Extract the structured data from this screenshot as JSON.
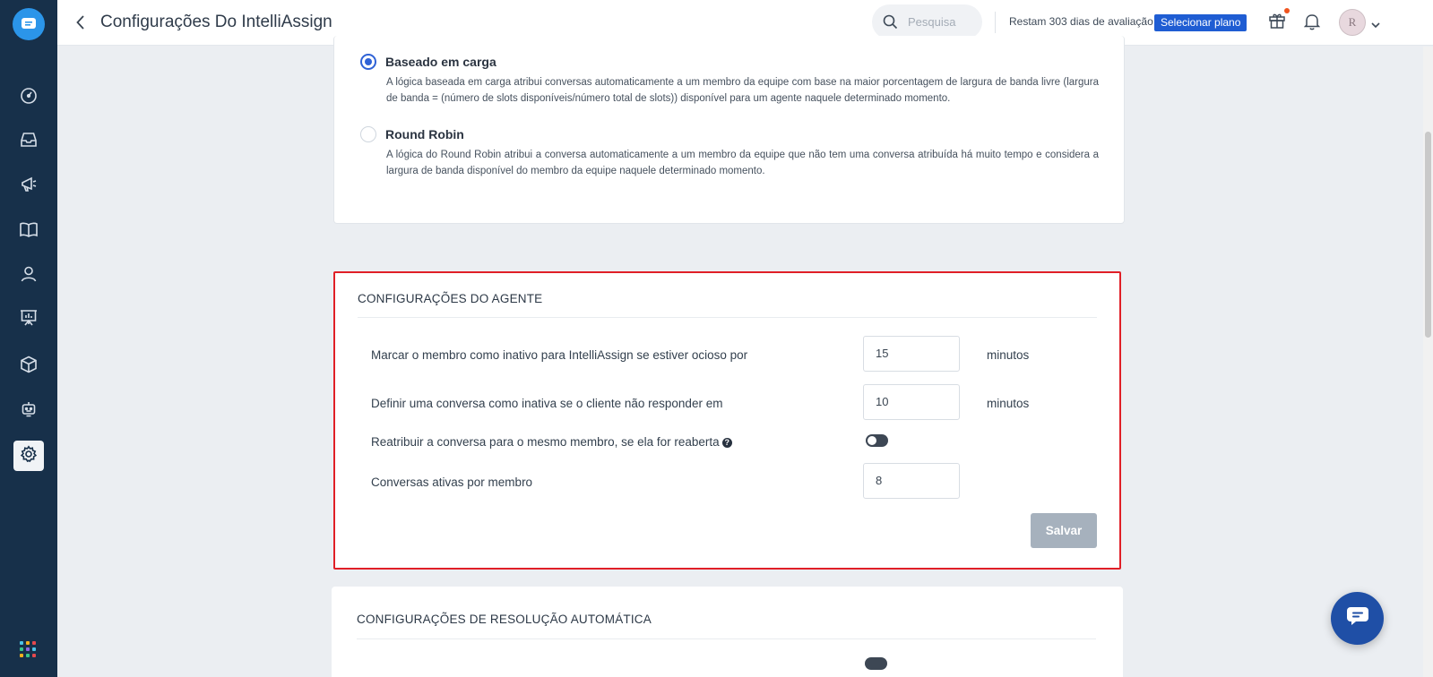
{
  "header": {
    "title": "Configurações Do IntelliAssign",
    "search_placeholder": "Pesquisa",
    "trial_text": "Restam 303 dias de avaliação",
    "plan_button": "Selecionar plano",
    "avatar_initial": "R"
  },
  "sidebar": {
    "items": [
      {
        "icon": "dashboard-icon"
      },
      {
        "icon": "inbox-icon"
      },
      {
        "icon": "megaphone-icon"
      },
      {
        "icon": "book-icon"
      },
      {
        "icon": "user-icon"
      },
      {
        "icon": "presentation-chart-icon"
      },
      {
        "icon": "package-icon"
      },
      {
        "icon": "bot-icon"
      },
      {
        "icon": "gear-icon",
        "active": true
      }
    ]
  },
  "logic": {
    "options": [
      {
        "title": "Baseado em carga",
        "description": "A lógica baseada em carga atribui conversas automaticamente a um membro da equipe com base na maior porcentagem de largura de banda livre (largura de banda = (número de slots disponíveis/número total de slots)) disponível para um agente naquele determinado momento.",
        "selected": true
      },
      {
        "title": "Round Robin",
        "description": "A lógica do Round Robin atribui a conversa automaticamente a um membro da equipe que não tem uma conversa atribuída há muito tempo e considera a largura de banda disponível do membro da equipe naquele determinado momento.",
        "selected": false
      }
    ]
  },
  "agent_settings": {
    "title": "CONFIGURAÇÕES DO AGENTE",
    "inactive_member_label": "Marcar o membro como inativo para IntelliAssign se estiver ocioso por",
    "inactive_member_value": "15",
    "inactive_member_unit": "minutos",
    "inactive_conversation_label": "Definir uma conversa como inativa se o cliente não responder em",
    "inactive_conversation_value": "10",
    "inactive_conversation_unit": "minutos",
    "reassign_label": "Reatribuir a conversa para o mesmo membro, se ela for reaberta",
    "reassign_enabled": false,
    "active_conversations_label": "Conversas ativas por membro",
    "active_conversations_value": "8",
    "save_button": "Salvar"
  },
  "auto_resolution": {
    "title": "CONFIGURAÇÕES DE RESOLUÇÃO AUTOMÁTICA"
  },
  "colors": {
    "sidebar": "#17304a",
    "accent": "#2f62d6",
    "highlight_border": "#e01f27",
    "plan_button": "#1f5dd3"
  }
}
